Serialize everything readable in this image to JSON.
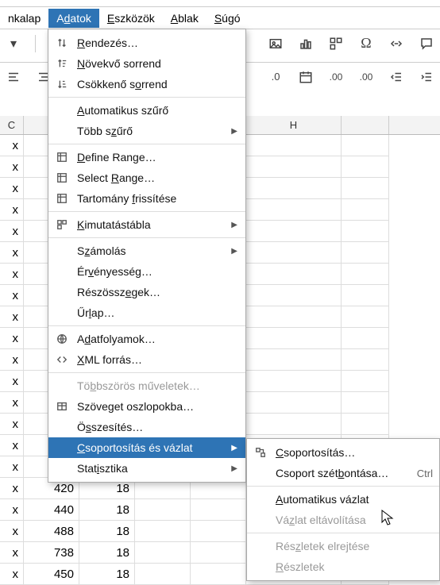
{
  "menubar": {
    "items": [
      {
        "pre": "",
        "u": "",
        "post": "nkalap"
      },
      {
        "pre": "A",
        "u": "d",
        "post": "atok",
        "active": true
      },
      {
        "pre": "",
        "u": "E",
        "post": "szközök"
      },
      {
        "pre": "",
        "u": "A",
        "post": "blak"
      },
      {
        "pre": "",
        "u": "S",
        "post": "úgó"
      }
    ]
  },
  "toolbar1": {
    "icons": [
      "caret-icon",
      "sep",
      "magnifier-icon"
    ],
    "right_icons": [
      "image-icon",
      "chart-icon",
      "pivot-icon",
      "omega-icon",
      "link-icon",
      "comment-icon"
    ]
  },
  "toolbar2": {
    "left_icons": [
      "indent-right-icon",
      "indent-left-icon"
    ],
    "number_format": ".0",
    "right_icons": [
      "date-icon",
      "add-decimal-icon",
      "remove-decimal-icon",
      "indent-dec-icon",
      "indent-inc-icon"
    ]
  },
  "menu": {
    "items": [
      {
        "icon": "sort-both-icon",
        "pre": "",
        "u": "R",
        "post": "endezés…"
      },
      {
        "icon": "sort-asc-icon",
        "pre": "",
        "u": "N",
        "post": "övekvő sorrend"
      },
      {
        "icon": "sort-desc-icon",
        "pre": "Csökkenő s",
        "u": "o",
        "post": "rrend"
      },
      {
        "sep": true
      },
      {
        "icon": "",
        "pre": "",
        "u": "A",
        "post": "utomatikus szűrő"
      },
      {
        "icon": "",
        "pre": "Több s",
        "u": "z",
        "post": "űrő",
        "submenu": true
      },
      {
        "sep": true
      },
      {
        "icon": "range-icon",
        "pre": "",
        "u": "D",
        "post": "efine Range…"
      },
      {
        "icon": "range-icon",
        "pre": "Select ",
        "u": "R",
        "post": "ange…"
      },
      {
        "icon": "range-icon",
        "pre": "Tartomány ",
        "u": "f",
        "post": "rissítése"
      },
      {
        "sep": true
      },
      {
        "icon": "pivot-icon",
        "pre": "",
        "u": "K",
        "post": "imutatástábla",
        "submenu": true
      },
      {
        "sep": true
      },
      {
        "icon": "",
        "pre": "S",
        "u": "z",
        "post": "ámolás",
        "submenu": true
      },
      {
        "icon": "",
        "pre": "Ér",
        "u": "v",
        "post": "ényesség…"
      },
      {
        "icon": "",
        "pre": "Részössz",
        "u": "e",
        "post": "gek…"
      },
      {
        "icon": "",
        "pre": "Űr",
        "u": "l",
        "post": "ap…"
      },
      {
        "sep": true
      },
      {
        "icon": "globe-icon",
        "pre": "A",
        "u": "d",
        "post": "atfolyamok…"
      },
      {
        "icon": "code-icon",
        "pre": "",
        "u": "X",
        "post": "ML forrás…"
      },
      {
        "sep": true
      },
      {
        "icon": "",
        "pre": "Tö",
        "u": "b",
        "post": "bszörös műveletek…",
        "disabled": true
      },
      {
        "icon": "table-icon",
        "pre": "Szöve",
        "u": "g",
        "post": "et oszlopokba…"
      },
      {
        "icon": "",
        "pre": "Ö",
        "u": "s",
        "post": "szesítés…"
      },
      {
        "icon": "",
        "pre": "",
        "u": "C",
        "post": "soportosítás és vázlat",
        "submenu": true,
        "highlight": true
      },
      {
        "icon": "",
        "pre": "Stat",
        "u": "i",
        "post": "sztika",
        "submenu": true
      }
    ]
  },
  "submenu": {
    "items": [
      {
        "icon": "group-icon",
        "pre": "",
        "u": "C",
        "post": "soportosítás…"
      },
      {
        "icon": "",
        "pre": "Csoport szét",
        "u": "b",
        "post": "ontása…",
        "shortcut": "Ctrl"
      },
      {
        "sep": true
      },
      {
        "icon": "",
        "pre": "",
        "u": "A",
        "post": "utomatikus vázlat"
      },
      {
        "icon": "",
        "pre": "Vá",
        "u": "z",
        "post": "lat eltávolítása",
        "disabled": true
      },
      {
        "sep": true
      },
      {
        "icon": "",
        "pre": "Rés",
        "u": "z",
        "post": "letek elrejtése",
        "disabled": true
      },
      {
        "icon": "",
        "pre": "",
        "u": "R",
        "post": "észletek",
        "disabled": true
      }
    ]
  },
  "columns": [
    "C",
    "",
    "",
    "",
    "",
    "H",
    ""
  ],
  "grid": {
    "visible_x": "x",
    "data_rows": [
      {
        "d": "420",
        "e": "18"
      },
      {
        "d": "440",
        "e": "18"
      },
      {
        "d": "488",
        "e": "18"
      },
      {
        "d": "738",
        "e": "18"
      },
      {
        "d": "450",
        "e": "18"
      }
    ]
  }
}
